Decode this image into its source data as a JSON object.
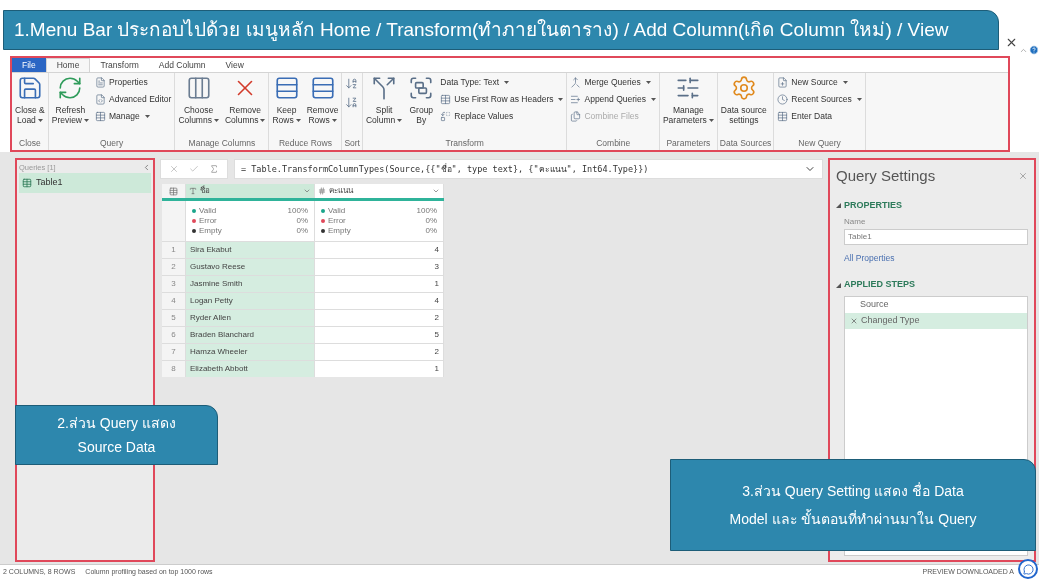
{
  "banner": {
    "text": "1.Menu Bar ประกอบไปด้วย เมนูหลัก Home / Transform(ทำภายในตาราง) / Add Column(เกิด Column ใหม่) / View"
  },
  "tabs": [
    {
      "label": "File",
      "kind": "file",
      "selected": false
    },
    {
      "label": "Home",
      "kind": "tab",
      "selected": true
    },
    {
      "label": "Transform",
      "kind": "tab",
      "selected": false
    },
    {
      "label": "Add Column",
      "kind": "tab",
      "selected": false
    },
    {
      "label": "View",
      "kind": "tab",
      "selected": false
    }
  ],
  "ribbon_groups": [
    {
      "label": "Close",
      "items": [
        {
          "kind": "large",
          "lines": [
            "Close &",
            "Load"
          ],
          "dropdown": true
        }
      ]
    },
    {
      "label": "Query",
      "items": [
        {
          "kind": "large",
          "lines": [
            "Refresh",
            "Preview"
          ],
          "dropdown": true
        },
        {
          "kind": "stack",
          "entries": [
            {
              "label": "Properties",
              "dropdown": false,
              "disabled": false
            },
            {
              "label": "Advanced Editor",
              "dropdown": false,
              "disabled": false
            },
            {
              "label": "Manage",
              "dropdown": true,
              "disabled": false
            }
          ]
        }
      ]
    },
    {
      "label": "Manage Columns",
      "items": [
        {
          "kind": "large",
          "lines": [
            "Choose",
            "Columns"
          ],
          "dropdown": true
        },
        {
          "kind": "large",
          "lines": [
            "Remove",
            "Columns"
          ],
          "dropdown": true
        }
      ]
    },
    {
      "label": "Reduce Rows",
      "items": [
        {
          "kind": "large",
          "lines": [
            "Keep",
            "Rows"
          ],
          "dropdown": true
        },
        {
          "kind": "large",
          "lines": [
            "Remove",
            "Rows"
          ],
          "dropdown": true
        }
      ]
    },
    {
      "label": "Sort",
      "items": [
        {
          "kind": "sort"
        }
      ]
    },
    {
      "label": "Transform",
      "items": [
        {
          "kind": "large",
          "lines": [
            "Split",
            "Column"
          ],
          "dropdown": true
        },
        {
          "kind": "large",
          "lines": [
            "Group",
            "By"
          ],
          "dropdown": false
        },
        {
          "kind": "stack",
          "entries": [
            {
              "label": "Data Type: Text",
              "dropdown": true,
              "disabled": false
            },
            {
              "label": "Use First Row as Headers",
              "dropdown": true,
              "disabled": false
            },
            {
              "label": "Replace Values",
              "dropdown": false,
              "disabled": false
            }
          ]
        }
      ]
    },
    {
      "label": "Combine",
      "items": [
        {
          "kind": "stack",
          "entries": [
            {
              "label": "Merge Queries",
              "dropdown": true,
              "disabled": false
            },
            {
              "label": "Append Queries",
              "dropdown": true,
              "disabled": false
            },
            {
              "label": "Combine Files",
              "dropdown": false,
              "disabled": true
            }
          ]
        }
      ]
    },
    {
      "label": "Parameters",
      "items": [
        {
          "kind": "large",
          "lines": [
            "Manage",
            "Parameters"
          ],
          "dropdown": true
        }
      ]
    },
    {
      "label": "Data Sources",
      "items": [
        {
          "kind": "large",
          "lines": [
            "Data source",
            "settings"
          ],
          "dropdown": false
        }
      ]
    },
    {
      "label": "New Query",
      "items": [
        {
          "kind": "stack",
          "entries": [
            {
              "label": "New Source",
              "dropdown": true,
              "disabled": false
            },
            {
              "label": "Recent Sources",
              "dropdown": true,
              "disabled": false
            },
            {
              "label": "Enter Data",
              "dropdown": false,
              "disabled": false
            }
          ]
        }
      ]
    }
  ],
  "queries": {
    "header": "Queries [1]",
    "items": [
      {
        "name": "Table1",
        "selected": true
      }
    ]
  },
  "formula": "= Table.TransformColumnTypes(Source,{{\"ชื่อ\", type text}, {\"คะแนน\", Int64.Type}})",
  "grid": {
    "columns": [
      {
        "name": "ชื่อ",
        "kind": "text",
        "selected": true,
        "quality": [
          {
            "label": "Valid",
            "value": "100%",
            "color": "#1aa58b"
          },
          {
            "label": "Error",
            "value": "0%",
            "color": "#e0485a"
          },
          {
            "label": "Empty",
            "value": "0%",
            "color": "#333333"
          }
        ]
      },
      {
        "name": "คะแนน",
        "kind": "number",
        "selected": false,
        "quality": [
          {
            "label": "Valid",
            "value": "100%",
            "color": "#1aa58b"
          },
          {
            "label": "Error",
            "value": "0%",
            "color": "#e0485a"
          },
          {
            "label": "Empty",
            "value": "0%",
            "color": "#333333"
          }
        ]
      }
    ],
    "rows": [
      {
        "index": "1",
        "cells": [
          "Sira Ekabut",
          "4"
        ]
      },
      {
        "index": "2",
        "cells": [
          "Gustavo Reese",
          "3"
        ]
      },
      {
        "index": "3",
        "cells": [
          "Jasmine Smith",
          "1"
        ]
      },
      {
        "index": "4",
        "cells": [
          "Logan Petty",
          "4"
        ]
      },
      {
        "index": "5",
        "cells": [
          "Ryder Allen",
          "2"
        ]
      },
      {
        "index": "6",
        "cells": [
          "Braden Blanchard",
          "5"
        ]
      },
      {
        "index": "7",
        "cells": [
          "Hamza Wheeler",
          "2"
        ]
      },
      {
        "index": "8",
        "cells": [
          "Elizabeth Abbott",
          "1"
        ]
      }
    ]
  },
  "settings": {
    "title": "Query Settings",
    "properties_heading": "PROPERTIES",
    "properties_expanded": true,
    "name_label": "Name",
    "name_value": "Table1",
    "all_properties": "All Properties",
    "steps_heading": "APPLIED STEPS",
    "steps_expanded": true,
    "steps": [
      {
        "label": "Source",
        "selected": false
      },
      {
        "label": "Changed Type",
        "selected": true
      }
    ]
  },
  "callouts": [
    {
      "lines": [
        "2.ส่วน Query แสดง",
        "Source Data"
      ]
    },
    {
      "lines": [
        "3.ส่วน Query Setting  แสดง ชื่อ Data",
        "Model และ ขั้นตอนที่ทำผ่านมาใน Query"
      ]
    }
  ],
  "status_bar": {
    "left": [
      "2 COLUMNS, 8 ROWS",
      "Column profiling based on top 1000 rows"
    ],
    "right": "PREVIEW DOWNLOADED A"
  }
}
